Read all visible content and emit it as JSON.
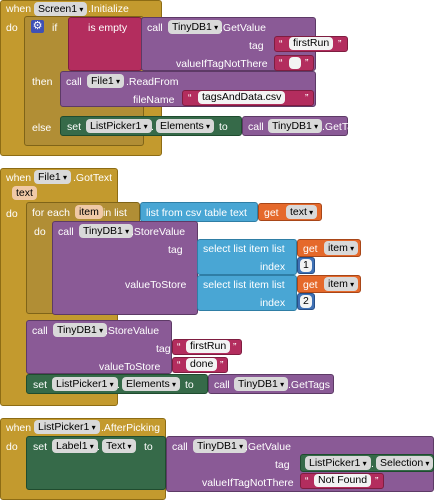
{
  "ev1": {
    "when": "when",
    "comp": "Screen1",
    "event": ".Initialize",
    "do": "do"
  },
  "if1": {
    "if": "if",
    "then": "then",
    "else": "else"
  },
  "isempty": "is empty",
  "gv1": {
    "call": "call",
    "comp": "TinyDB1",
    "method": ".GetValue",
    "tag_label": "tag",
    "tag_value": "firstRun",
    "vitnt": "valueIfTagNotThere",
    "empty": ""
  },
  "rf": {
    "call": "call",
    "comp": "File1",
    "method": ".ReadFrom",
    "fn_label": "fileName",
    "fn_value": "tagsAndData.csv"
  },
  "set1": {
    "set": "set",
    "comp": "ListPicker1",
    "prop": "Elements",
    "to": "to",
    "call": "call",
    "db": "TinyDB1",
    "method": ".GetTags"
  },
  "ev2": {
    "when": "when",
    "comp": "File1",
    "event": ".GotText",
    "param": "text",
    "do": "do"
  },
  "fe": {
    "for_each": "for each",
    "item": "item",
    "in_list": "in list",
    "csv": "list from csv table  text",
    "get": "get",
    "text": "text",
    "do": "do"
  },
  "sv1": {
    "call": "call",
    "comp": "TinyDB1",
    "method": ".StoreValue",
    "tag": "tag",
    "vts": "valueToStore"
  },
  "sel": {
    "label": "select list item  list",
    "get": "get",
    "item": "item",
    "index": "index",
    "i1": "1",
    "i2": "2"
  },
  "sv2": {
    "call": "call",
    "comp": "TinyDB1",
    "method": ".StoreValue",
    "tag": "tag",
    "tag_value": "firstRun",
    "vts": "valueToStore",
    "vts_value": "done"
  },
  "set2": {
    "set": "set",
    "comp": "ListPicker1",
    "prop": "Elements",
    "to": "to",
    "call": "call",
    "db": "TinyDB1",
    "method": ".GetTags"
  },
  "ev3": {
    "when": "when",
    "comp": "ListPicker1",
    "event": ".AfterPicking",
    "do": "do"
  },
  "set3": {
    "set": "set",
    "comp": "Label1",
    "prop": "Text",
    "to": "to"
  },
  "gv2": {
    "call": "call",
    "comp": "TinyDB1",
    "method": ".GetValue",
    "tag": "tag",
    "lp": "ListPicker1",
    "sel": "Selection",
    "vitnt": "valueIfTagNotThere",
    "nf": "Not Found"
  }
}
